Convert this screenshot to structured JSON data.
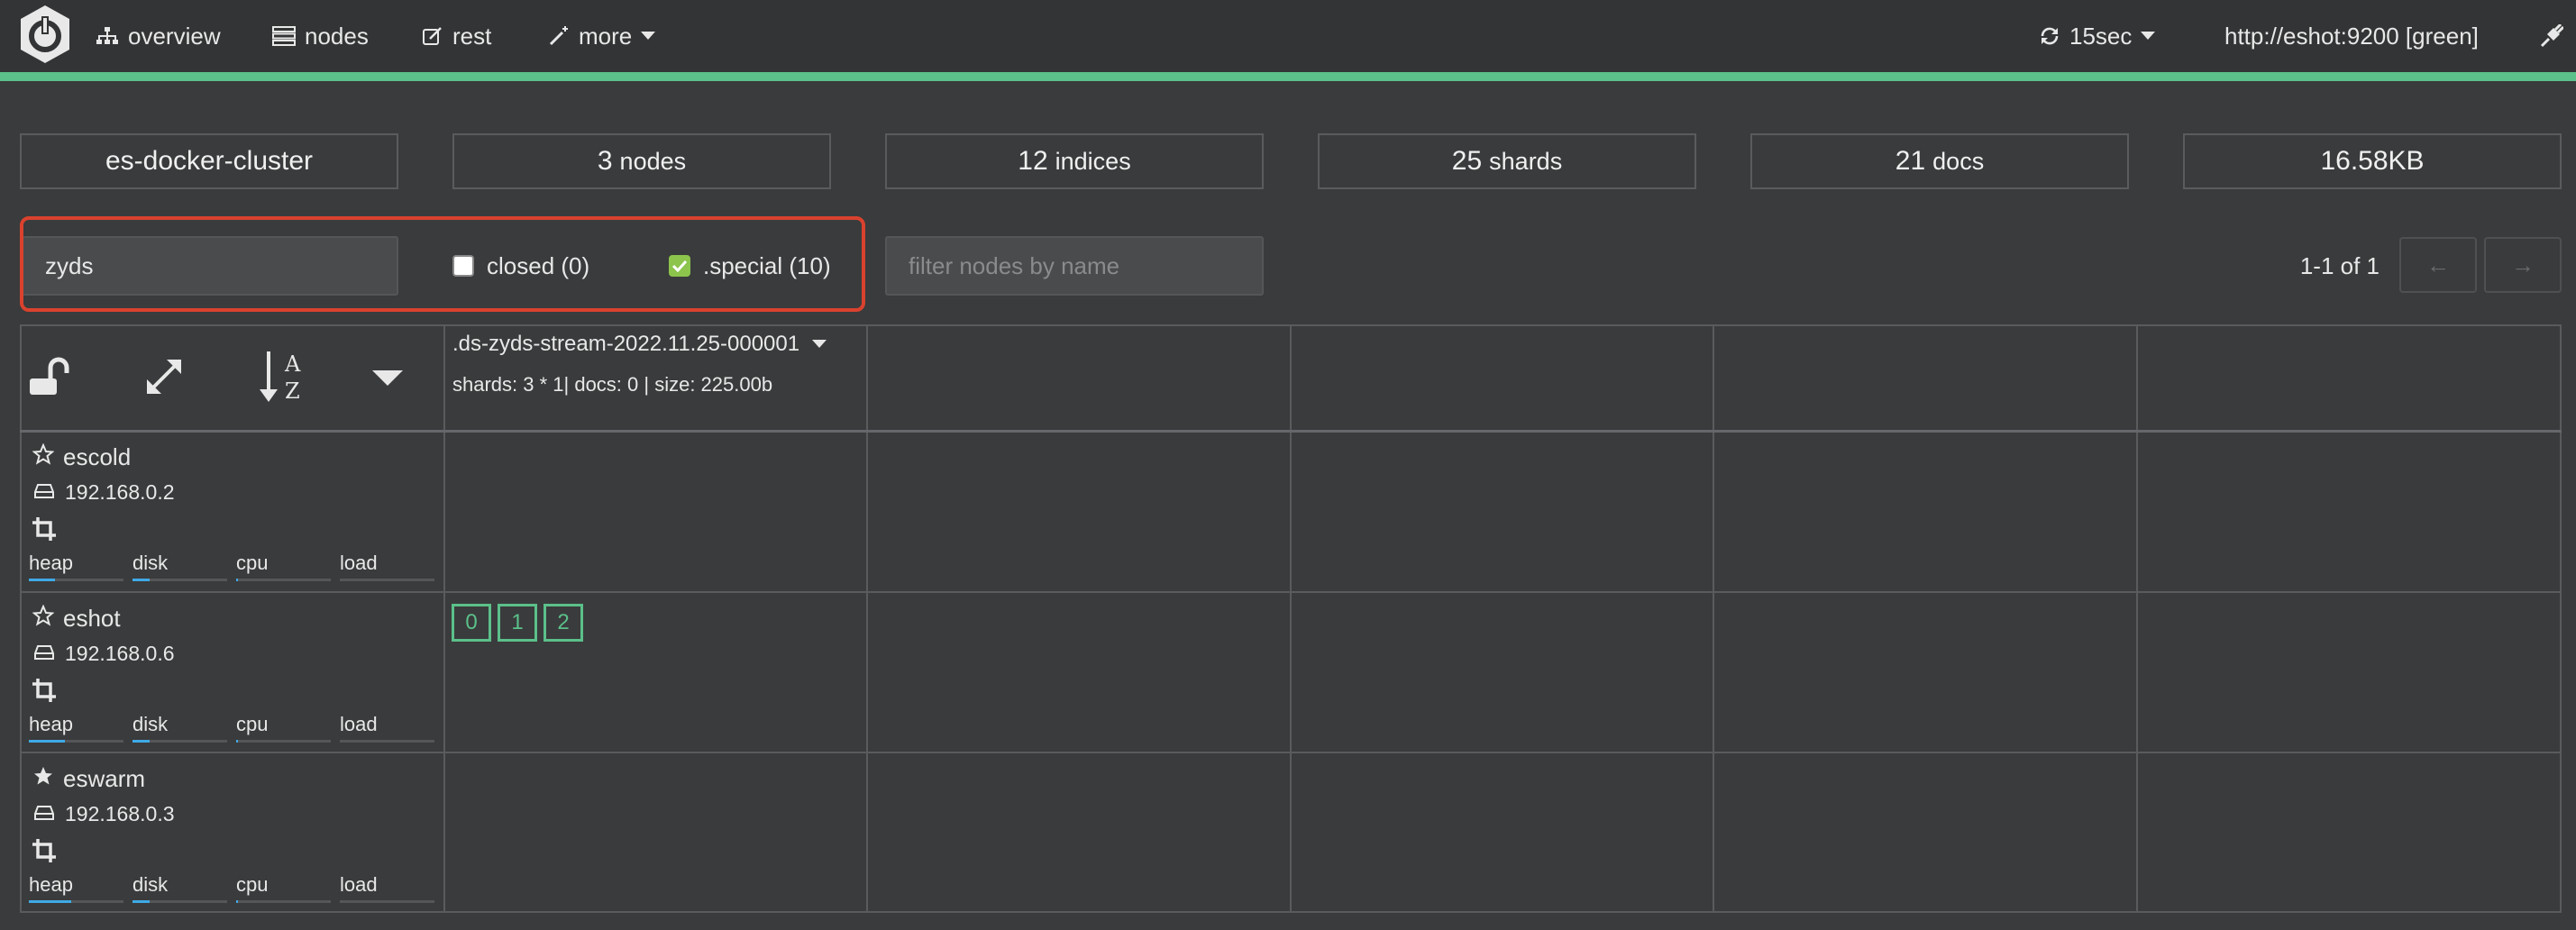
{
  "nav": {
    "items": [
      {
        "label": "overview",
        "icon": "sitemap-icon"
      },
      {
        "label": "nodes",
        "icon": "server-icon"
      },
      {
        "label": "rest",
        "icon": "edit-icon"
      },
      {
        "label": "more",
        "icon": "magic-wand-icon"
      }
    ],
    "refresh_label": "15sec",
    "host_label": "http://eshot:9200 [green]",
    "accent_color": "#5bc08a"
  },
  "stats": {
    "cluster_name": "es-docker-cluster",
    "nodes_value": "3",
    "nodes_unit": "nodes",
    "indices_value": "12",
    "indices_unit": "indices",
    "shards_value": "25",
    "shards_unit": "shards",
    "docs_value": "21",
    "docs_unit": "docs",
    "size": "16.58KB"
  },
  "filter": {
    "index_filter_value": "zyds",
    "closed_label": "closed (0)",
    "closed_checked": false,
    "special_label": ".special (10)",
    "special_checked": true,
    "node_filter_placeholder": "filter nodes by name",
    "pagination": "1-1 of 1",
    "prev_label": "←",
    "next_label": "→"
  },
  "index": {
    "name": ".ds-zyds-stream-2022.11.25-000001",
    "meta": "shards: 3 * 1| docs: 0 | size: 225.00b"
  },
  "nodes": [
    {
      "name": "escold",
      "ip": "192.168.0.2",
      "master": false,
      "heap": 0.28,
      "disk": 0.18,
      "cpu": 0.02,
      "load": 0.0
    },
    {
      "name": "eshot",
      "ip": "192.168.0.6",
      "master": false,
      "heap": 0.38,
      "disk": 0.18,
      "cpu": 0.02,
      "load": 0.0,
      "shards": [
        "0",
        "1",
        "2"
      ]
    },
    {
      "name": "eswarm",
      "ip": "192.168.0.3",
      "master": true,
      "heap": 0.45,
      "disk": 0.18,
      "cpu": 0.02,
      "load": 0.0
    }
  ],
  "metric_labels": {
    "heap": "heap",
    "disk": "disk",
    "cpu": "cpu",
    "load": "load"
  }
}
